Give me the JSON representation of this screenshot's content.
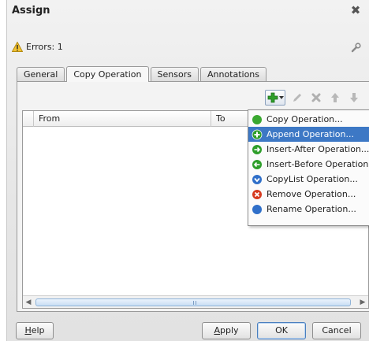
{
  "window": {
    "title": "Assign"
  },
  "status": {
    "errors": "Errors: 1"
  },
  "tabs": [
    {
      "label": "General",
      "active": false
    },
    {
      "label": "Copy Operation",
      "active": true
    },
    {
      "label": "Sensors",
      "active": false
    },
    {
      "label": "Annotations",
      "active": false
    }
  ],
  "table": {
    "columns": [
      "From",
      "To"
    ]
  },
  "menu": {
    "items": [
      {
        "label": "Copy Operation...",
        "icon": "copy-operation-icon",
        "color": "#3aa830",
        "highlighted": false
      },
      {
        "label": "Append Operation...",
        "icon": "append-operation-icon",
        "color": "#2e9e2a",
        "highlighted": true
      },
      {
        "label": "Insert-After Operation...",
        "icon": "insert-after-icon",
        "color": "#2e9e2a",
        "highlighted": false
      },
      {
        "label": "Insert-Before Operation...",
        "icon": "insert-before-icon",
        "color": "#2e9e2a",
        "highlighted": false
      },
      {
        "label": "CopyList Operation...",
        "icon": "copylist-operation-icon",
        "color": "#2f6fc9",
        "highlighted": false
      },
      {
        "label": "Remove Operation...",
        "icon": "remove-operation-icon",
        "color": "#d63a1f",
        "highlighted": false
      },
      {
        "label": "Rename Operation...",
        "icon": "rename-operation-icon",
        "color": "#2f6fc9",
        "highlighted": false
      }
    ]
  },
  "buttons": {
    "help": {
      "mnemonic": "H",
      "rest": "elp"
    },
    "apply": {
      "mnemonic": "A",
      "rest": "pply"
    },
    "ok": "OK",
    "cancel": "Cancel"
  },
  "colors": {
    "accent": "#3d78c5",
    "add": "#2e9e2a"
  }
}
